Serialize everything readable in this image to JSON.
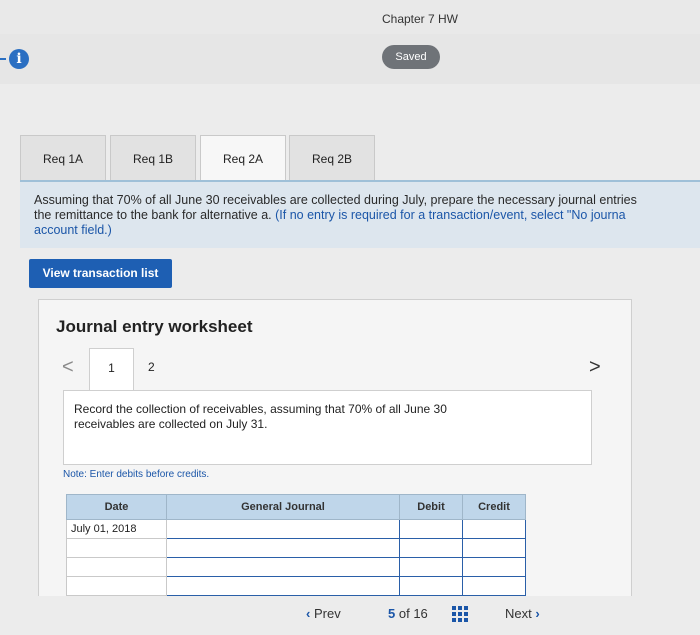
{
  "header": {
    "title": "Chapter 7 HW",
    "saved_label": "Saved",
    "info_icon": "info-icon"
  },
  "tabs": [
    {
      "label": "Req 1A",
      "active": false
    },
    {
      "label": "Req 1B",
      "active": false
    },
    {
      "label": "Req 2A",
      "active": true
    },
    {
      "label": "Req 2B",
      "active": false
    }
  ],
  "instructions": {
    "line1": "Assuming that 70% of all June 30 receivables are collected during July, prepare the necessary journal entries",
    "line2_plain": "the remittance to the bank for alternative a.",
    "line2_hl": "(If no entry is required for a transaction/event, select \"No journa",
    "line3_hl": "account field.)"
  },
  "view_button": "View transaction list",
  "worksheet": {
    "title": "Journal entry worksheet",
    "pages": [
      "1",
      "2"
    ],
    "prev_glyph": "<",
    "next_glyph": ">",
    "description_line1": "Record the collection of receivables, assuming that 70% of all June 30",
    "description_line2": "receivables are collected on July 31.",
    "note": "Note: Enter debits before credits.",
    "columns": {
      "date": "Date",
      "journal": "General Journal",
      "debit": "Debit",
      "credit": "Credit"
    },
    "rows": [
      {
        "date": "July 01, 2018",
        "account": "",
        "debit": "",
        "credit": ""
      },
      {
        "date": "",
        "account": "",
        "debit": "",
        "credit": ""
      },
      {
        "date": "",
        "account": "",
        "debit": "",
        "credit": ""
      },
      {
        "date": "",
        "account": "",
        "debit": "",
        "credit": ""
      }
    ]
  },
  "footer": {
    "prev": "Prev",
    "current": "5",
    "of_label": "of 16",
    "next": "Next"
  },
  "colors": {
    "accent": "#1e5fb3",
    "tab_line": "#9fc0d8",
    "header_cell": "#bfd6ea"
  }
}
